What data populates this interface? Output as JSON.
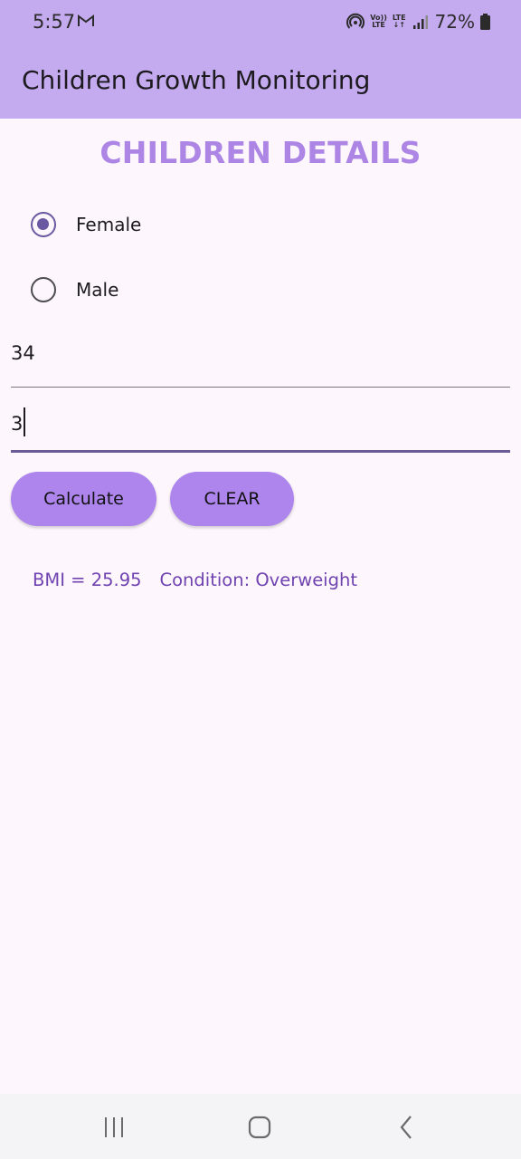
{
  "status_bar": {
    "time": "5:57",
    "notification_icons": [
      "gmail-icon"
    ],
    "right_icons": [
      "hotspot-icon",
      "volte-icon",
      "lte-data-icon",
      "signal-icon",
      "battery-icon"
    ],
    "volte_top": "Vo))",
    "volte_bottom": "LTE",
    "lte_label": "LTE",
    "battery": "72%"
  },
  "app_bar": {
    "title": "Children Growth Monitoring",
    "background_color": "#c4aaee"
  },
  "page": {
    "heading": "CHILDREN DETAILS",
    "heading_color": "#ad85e4",
    "background_color": "#fdf7fd"
  },
  "gender": {
    "options": [
      {
        "label": "Female",
        "selected": true
      },
      {
        "label": "Male",
        "selected": false
      }
    ]
  },
  "inputs": {
    "first_value": "34",
    "second_value": "3"
  },
  "buttons": {
    "calculate_label": "Calculate",
    "clear_label": "CLEAR",
    "color": "#ad85ec"
  },
  "result": {
    "bmi_text": "BMI = 25.95",
    "condition_text": "Condition: Overweight",
    "color": "#7043b0"
  },
  "nav_bar": {
    "buttons": [
      "recent-apps-icon",
      "home-icon",
      "back-icon"
    ]
  }
}
